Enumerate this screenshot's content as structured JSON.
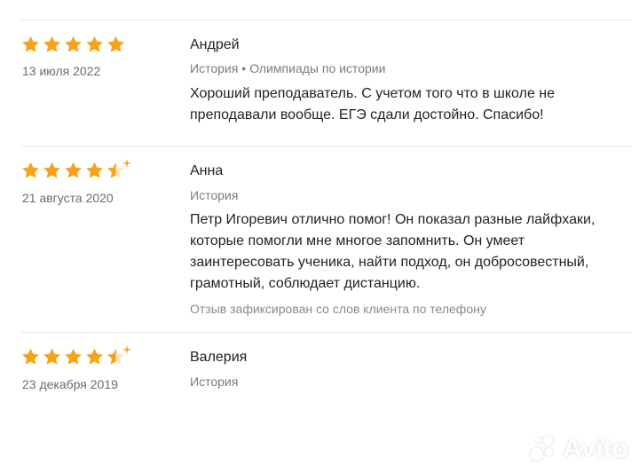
{
  "colors": {
    "star": "#f7a21b",
    "divider": "#e8e8e8",
    "muted_text": "#7a7a7a"
  },
  "reviews": [
    {
      "name": "Андрей",
      "date": "13 июля 2022",
      "rating": 5,
      "subject": "История",
      "subject_extra": "Олимпиады по истории",
      "text": "Хороший преподаватель. С учетом того что в школе не преподавали вообще. ЕГЭ сдали достойно. Спасибо!",
      "note": ""
    },
    {
      "name": "Анна",
      "date": "21 августа 2020",
      "rating": 4.5,
      "subject": "История",
      "subject_extra": "",
      "text": "Петр Игоревич отлично помог! Он показал разные лайфхаки, которые помогли мне многое запомнить. Он умеет заинтересовать ученика, найти подход, он добросовестный, грамотный, соблюдает дистанцию.",
      "note": "Отзыв зафиксирован со слов клиента по телефону"
    },
    {
      "name": "Валерия",
      "date": "23 декабря 2019",
      "rating": 4.5,
      "subject": "История",
      "subject_extra": "",
      "text": "",
      "note": ""
    }
  ],
  "watermark": {
    "text": "Avito",
    "icon": "avito-logo-icon"
  }
}
